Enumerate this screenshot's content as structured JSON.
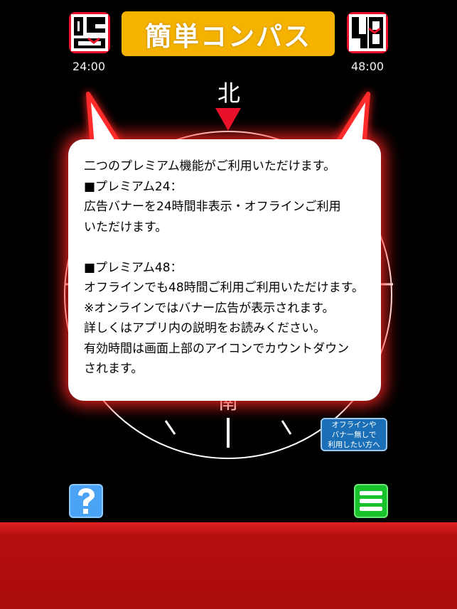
{
  "header": {
    "title": "簡単コンパス",
    "left_icon_label": "24",
    "right_icon_label": "48",
    "left_timer": "24:00",
    "right_timer": "48:00"
  },
  "compass": {
    "north_label": "北",
    "south_label": "南",
    "accent_color": "#e8102a"
  },
  "popup": {
    "lines": [
      "二つのプレミアム機能がご利用いただけます。",
      "■プレミアム24：",
      "広告バナーを24時間非表示・オフラインご利用",
      "いただけます。",
      "",
      "■プレミアム48：",
      "オフラインでも48時間ご利用ご利用いただけます。",
      "※オンラインではバナー広告が表示されます。",
      "詳しくはアプリ内の説明をお読みください。",
      "有効時間は画面上部のアイコンでカウントダウン",
      "されます。"
    ]
  },
  "offline_badge": {
    "line1": "オフラインや",
    "line2": "バナー無しで",
    "line3": "利用したい方へ"
  },
  "buttons": {
    "help_label": "?",
    "help_icon": "question-icon",
    "menu_icon": "hamburger-menu-icon"
  },
  "colors": {
    "title_bg": "#f5b300",
    "bottom_bar": "#b70f0f",
    "help_bg": "#4aa3f5",
    "menu_bg": "#18c22b",
    "badge_bg": "#1a6fb7"
  }
}
